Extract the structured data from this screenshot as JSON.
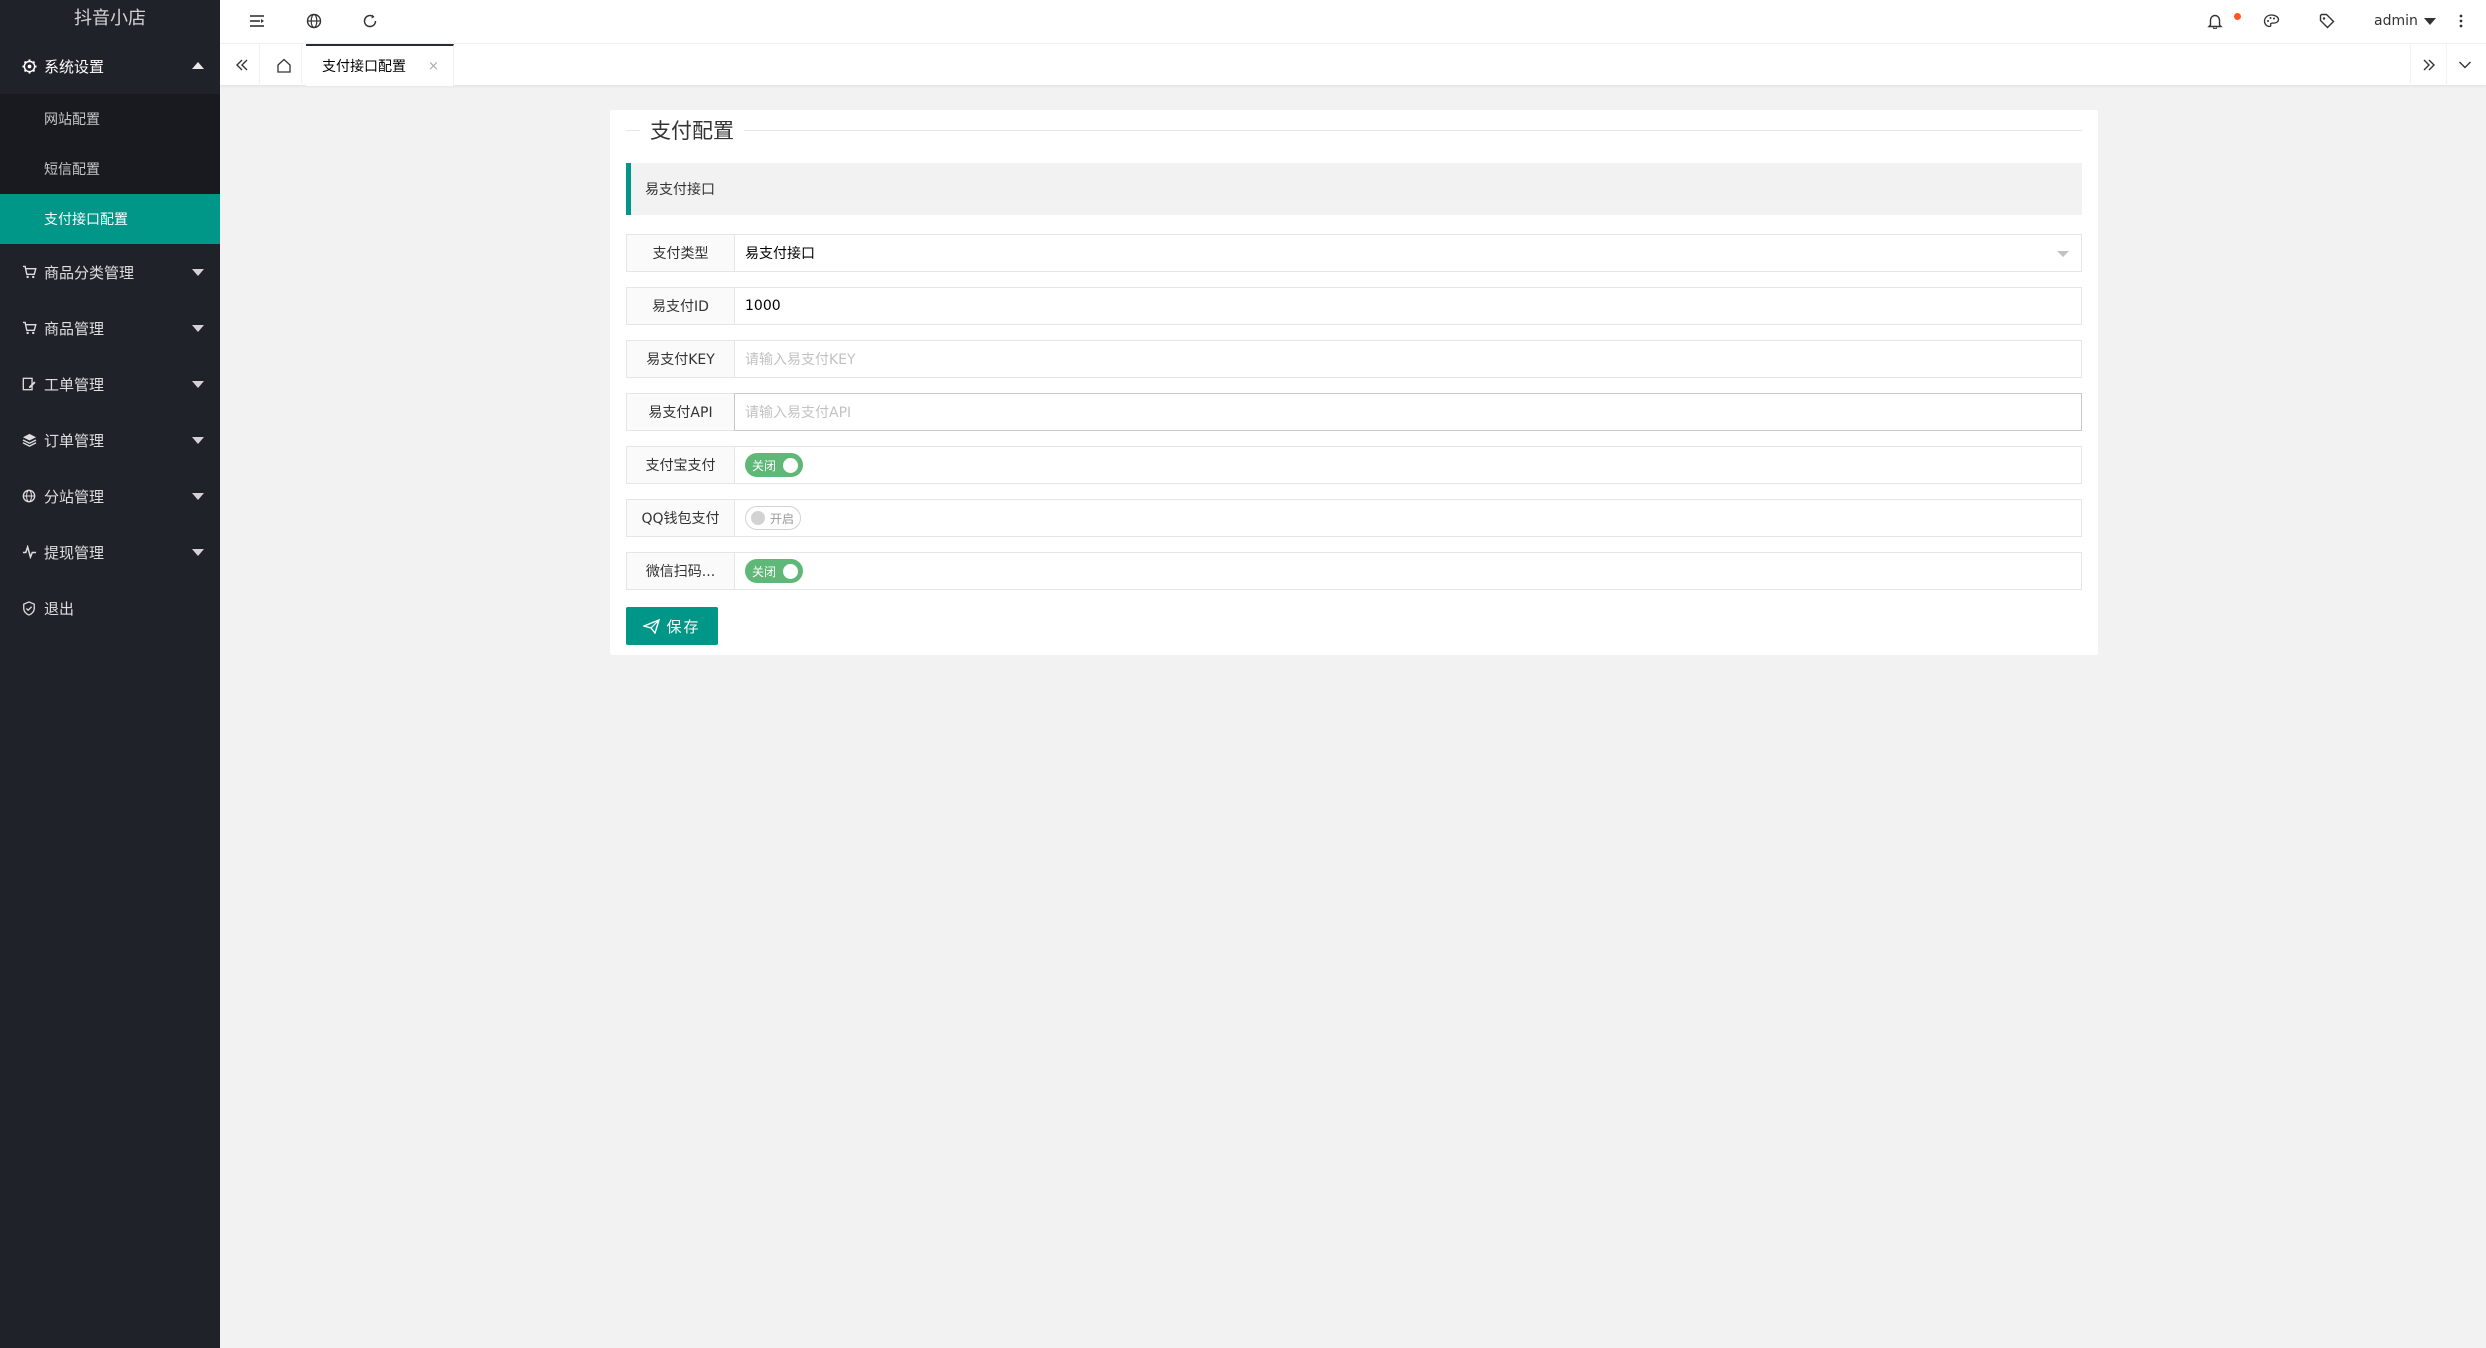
{
  "app": {
    "logo": "抖音小店"
  },
  "sidebar": {
    "items": [
      {
        "label": "系统设置",
        "icon": "gear-icon",
        "open": true,
        "children": [
          {
            "label": "网站配置"
          },
          {
            "label": "短信配置"
          },
          {
            "label": "支付接口配置",
            "active": true
          }
        ]
      },
      {
        "label": "商品分类管理",
        "icon": "cart-icon"
      },
      {
        "label": "商品管理",
        "icon": "cart-icon"
      },
      {
        "label": "工单管理",
        "icon": "edit-icon"
      },
      {
        "label": "订单管理",
        "icon": "layers-icon"
      },
      {
        "label": "分站管理",
        "icon": "globe-icon"
      },
      {
        "label": "提现管理",
        "icon": "activity-icon"
      },
      {
        "label": "退出",
        "icon": "shield-check-icon"
      }
    ]
  },
  "header": {
    "user": "admin"
  },
  "tabs": {
    "active_tab": "支付接口配置",
    "close": "×"
  },
  "card": {
    "legend": "支付配置",
    "quote": "易支付接口",
    "fields": {
      "pay_type": {
        "label": "支付类型",
        "value": "易支付接口"
      },
      "pay_id": {
        "label": "易支付ID",
        "value": "1000"
      },
      "pay_key": {
        "label": "易支付KEY",
        "placeholder": "请输入易支付KEY"
      },
      "pay_api": {
        "label": "易支付API",
        "placeholder": "请输入易支付API"
      },
      "alipay": {
        "label": "支付宝支付",
        "switch_text": "关闭"
      },
      "qqpay": {
        "label": "QQ钱包支付",
        "switch_text": "开启"
      },
      "wxpay": {
        "label": "微信扫码...",
        "switch_text": "关闭"
      }
    },
    "save_label": "保存"
  },
  "colors": {
    "accent": "#009688",
    "switch_on": "#5fb878",
    "sidebar_bg": "#20222a",
    "badge": "#ff5722"
  }
}
